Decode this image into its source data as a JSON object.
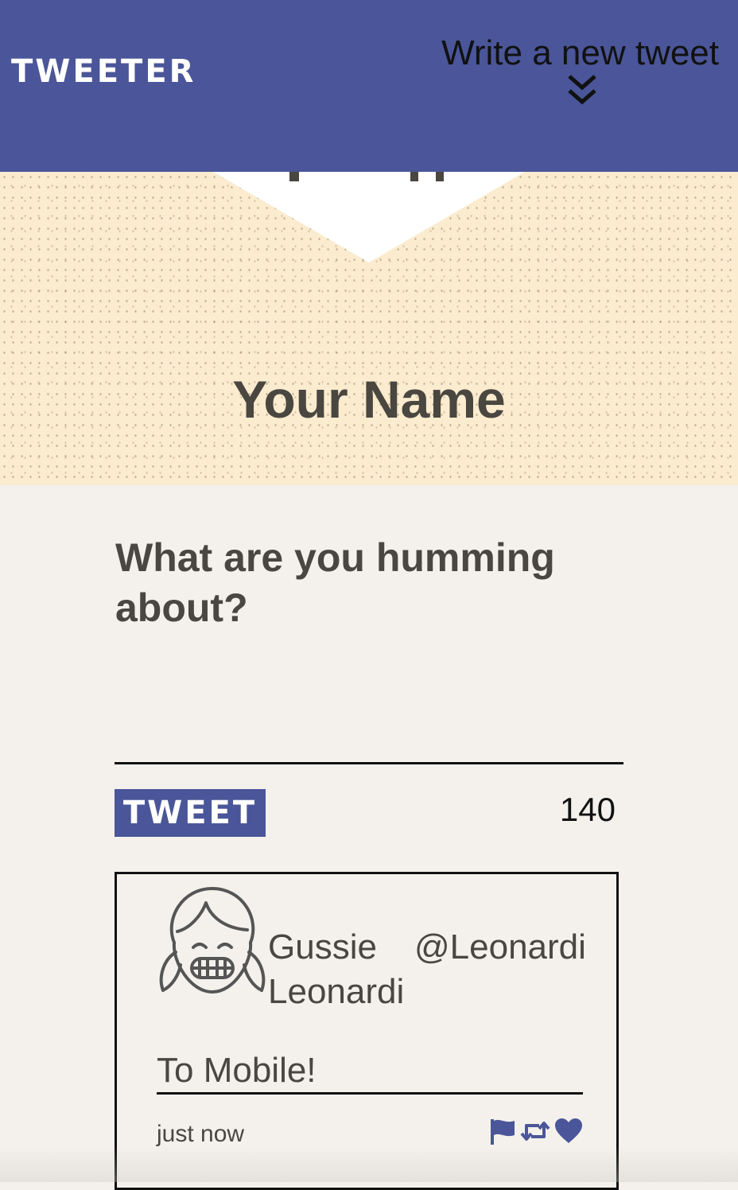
{
  "header": {
    "brand": "TWEETER",
    "write_label": "Write a new tweet",
    "write_icon": "double-chevron-down-icon"
  },
  "banner": {
    "name": "Your Name"
  },
  "compose": {
    "prompt": "What are you humming about?",
    "input_value": "",
    "tweet_button": "TWEET",
    "char_count": "140"
  },
  "tweet": {
    "avatar_icon": "girl-avatar-icon",
    "name": "Gussie Leonardi",
    "handle": "@Leonardi",
    "content": "To Mobile!",
    "timestamp": "just now",
    "actions": [
      "flag-icon",
      "retweet-icon",
      "heart-icon"
    ]
  },
  "colors": {
    "header_bg": "#4a5699",
    "banner_bg": "#fbebcf",
    "page_bg": "#f4f1ec",
    "text": "#4a4640",
    "accent": "#4a5699"
  }
}
